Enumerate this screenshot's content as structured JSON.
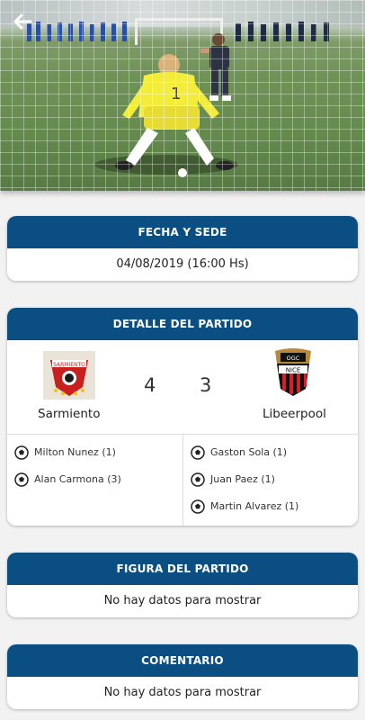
{
  "header": {
    "back_icon": "arrow-left-icon",
    "carousel_dots": 1
  },
  "date_section": {
    "title": "FECHA Y SEDE",
    "value": "04/08/2019 (16:00 Hs)"
  },
  "match_section": {
    "title": "DETALLE DEL PARTIDO",
    "home": {
      "name": "Sarmiento",
      "score": "4"
    },
    "away": {
      "name": "Libeerpool",
      "score": "3"
    },
    "home_scorers": [
      "Milton Nunez (1)",
      "Alan Carmona (3)"
    ],
    "away_scorers": [
      "Gaston Sola (1)",
      "Juan Paez (1)",
      "Martin Alvarez (1)"
    ]
  },
  "figure_section": {
    "title": "FIGURA DEL PARTIDO",
    "value": "No hay datos para mostrar"
  },
  "comment_section": {
    "title": "COMENTARIO",
    "value": "No hay datos para mostrar"
  },
  "colors": {
    "header_blue": "#0b4f82",
    "background": "#f2f2f2"
  }
}
